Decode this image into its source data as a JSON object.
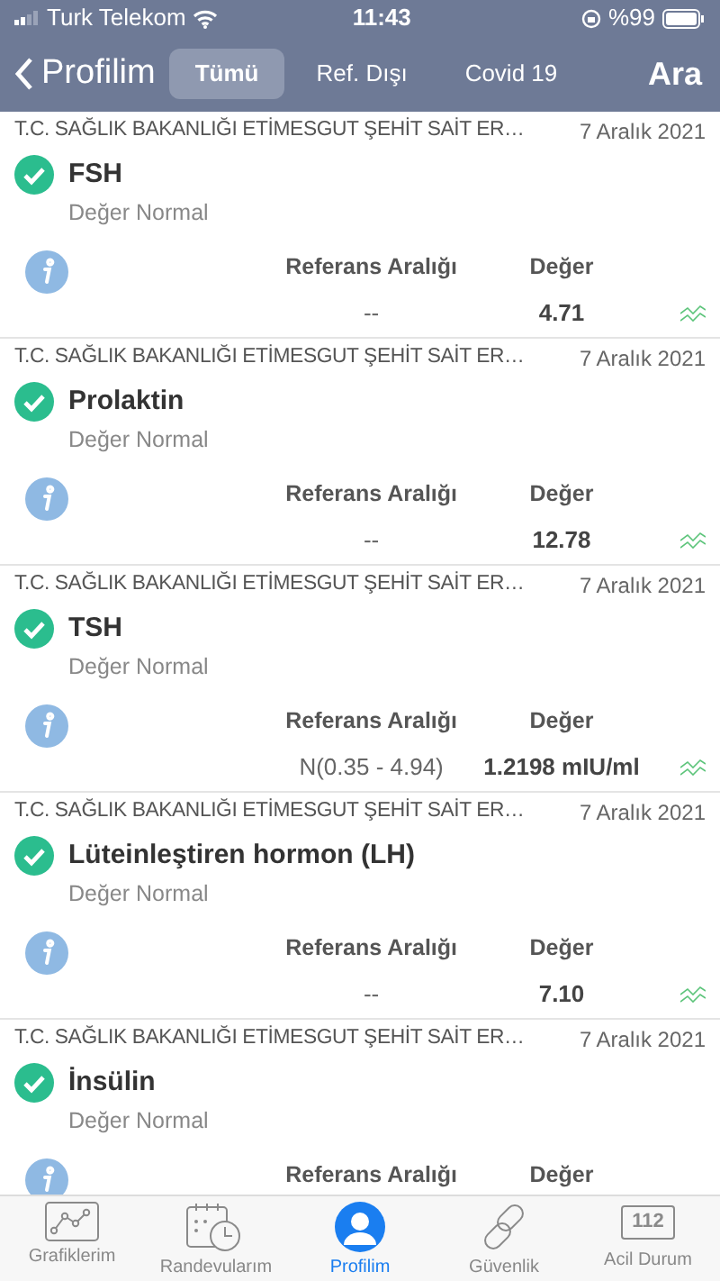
{
  "status_bar": {
    "carrier": "Turk Telekom",
    "time": "11:43",
    "battery": "%99"
  },
  "nav_bar": {
    "back": "Profilim",
    "segments": [
      {
        "label": "Tümü",
        "selected": true
      },
      {
        "label": "Ref. Dışı",
        "selected": false
      },
      {
        "label": "Covid 19",
        "selected": false
      }
    ],
    "action": "Ara"
  },
  "results": [
    {
      "hospital": "T.C. SAĞLIK BAKANLIĞI ETİMESGUT ŞEHİT SAİT ER…",
      "date": "7 Aralık 2021",
      "test": "FSH",
      "status": "Değer Normal",
      "normal": true,
      "range_label": "Referans Aralığı",
      "value_label": "Değer",
      "range": "--",
      "value": "4.71"
    },
    {
      "hospital": "T.C. SAĞLIK BAKANLIĞI ETİMESGUT ŞEHİT SAİT ER…",
      "date": "7 Aralık 2021",
      "test": "Prolaktin",
      "status": "Değer Normal",
      "normal": true,
      "range_label": "Referans Aralığı",
      "value_label": "Değer",
      "range": "--",
      "value": "12.78"
    },
    {
      "hospital": "T.C. SAĞLIK BAKANLIĞI ETİMESGUT ŞEHİT SAİT ER…",
      "date": "7 Aralık 2021",
      "test": "TSH",
      "status": "Değer Normal",
      "normal": true,
      "range_label": "Referans Aralığı",
      "value_label": "Değer",
      "range": "N(0.35 - 4.94)",
      "value": "1.2198 mIU/ml"
    },
    {
      "hospital": "T.C. SAĞLIK BAKANLIĞI ETİMESGUT ŞEHİT SAİT ER…",
      "date": "7 Aralık 2021",
      "test": "Lüteinleştiren hormon (LH)",
      "status": "Değer Normal",
      "normal": true,
      "range_label": "Referans Aralığı",
      "value_label": "Değer",
      "range": "--",
      "value": "7.10"
    },
    {
      "hospital": "T.C. SAĞLIK BAKANLIĞI ETİMESGUT ŞEHİT SAİT ER…",
      "date": "7 Aralık 2021",
      "test": "İnsülin",
      "status": "Değer Normal",
      "normal": true,
      "range_label": "Referans Aralığı",
      "value_label": "Değer"
    }
  ],
  "tab_bar": [
    {
      "label": "Grafiklerim",
      "kind": "chart",
      "selected": false
    },
    {
      "label": "Randevularım",
      "kind": "calendar",
      "selected": false
    },
    {
      "label": "Profilim",
      "kind": "person",
      "selected": true
    },
    {
      "label": "Güvenlik",
      "kind": "link",
      "selected": false
    },
    {
      "label": "Acil Durum",
      "kind": "number",
      "icon_text": "112",
      "selected": false
    }
  ]
}
